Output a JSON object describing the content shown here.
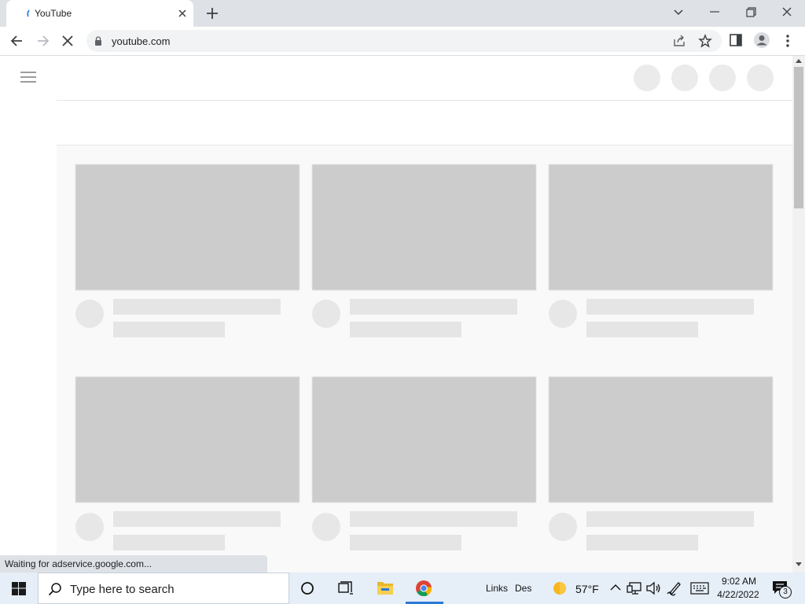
{
  "browser": {
    "tab_title": "YouTube",
    "url": "youtube.com",
    "status_text": "Waiting for adservice.google.com..."
  },
  "taskbar": {
    "search_placeholder": "Type here to search",
    "links_label": "Links",
    "desktop_label": "Des",
    "weather_temp": "57°F",
    "time": "9:02 AM",
    "date": "4/22/2022",
    "notification_count": "3"
  },
  "icons": {
    "tab_favicon": "loading-spinner-icon",
    "back": "arrow-left-icon",
    "forward": "arrow-right-icon",
    "reload": "stop-loading-icon",
    "lock": "lock-icon",
    "share": "share-icon",
    "bookmark": "star-icon",
    "side_panel": "side-panel-icon",
    "profile": "profile-icon",
    "menu": "kebab-menu-icon",
    "hamburger": "hamburger-menu-icon"
  },
  "colors": {
    "skeleton_thumb": "#cccccc",
    "skeleton_line": "#e5e5e5",
    "taskbar": "#e6eef7",
    "tabstrip": "#dee1e6"
  }
}
